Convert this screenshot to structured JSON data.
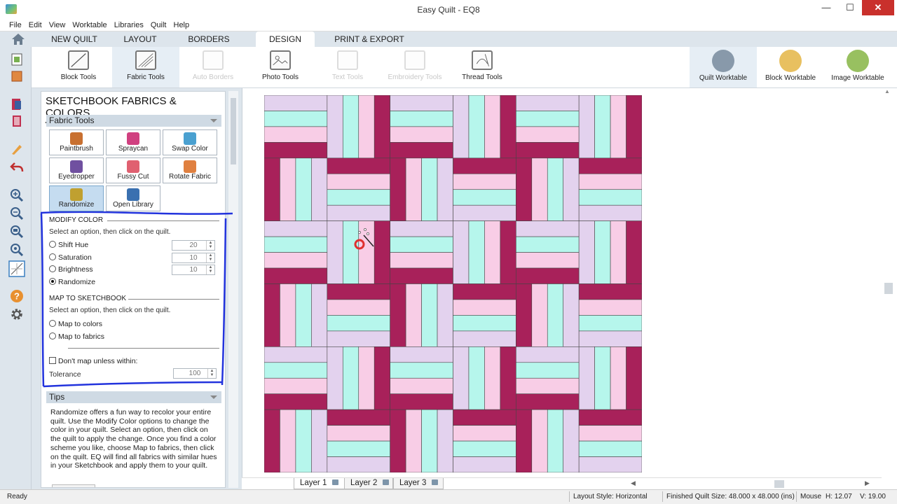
{
  "window": {
    "title": "Easy Quilt - EQ8",
    "minimize": "—",
    "maximize": "☐",
    "close": "✕"
  },
  "menu": [
    "File",
    "Edit",
    "View",
    "Worktable",
    "Libraries",
    "Quilt",
    "Help"
  ],
  "tabs": [
    {
      "label": "NEW QUILT"
    },
    {
      "label": "LAYOUT"
    },
    {
      "label": "BORDERS"
    },
    {
      "label": "DESIGN",
      "active": true
    },
    {
      "label": "PRINT & EXPORT"
    }
  ],
  "ribbon_tools": [
    {
      "label": "Block Tools",
      "enabled": true,
      "icon": "block-tools-icon"
    },
    {
      "label": "Fabric Tools",
      "enabled": true,
      "active": true,
      "icon": "fabric-tools-icon"
    },
    {
      "label": "Auto Borders",
      "enabled": false,
      "icon": "auto-borders-icon"
    },
    {
      "label": "Photo Tools",
      "enabled": true,
      "icon": "photo-tools-icon"
    },
    {
      "label": "Text Tools",
      "enabled": false,
      "icon": "text-tools-icon"
    },
    {
      "label": "Embroidery Tools",
      "enabled": false,
      "icon": "embroidery-tools-icon"
    },
    {
      "label": "Thread Tools",
      "enabled": true,
      "icon": "thread-tools-icon"
    }
  ],
  "worktables": [
    {
      "label": "Quilt Worktable",
      "active": true,
      "color": "#8899aa"
    },
    {
      "label": "Block Worktable",
      "color": "#e8c060"
    },
    {
      "label": "Image Worktable",
      "color": "#98c060"
    }
  ],
  "panel": {
    "title": "SKETCHBOOK FABRICS & COLORS",
    "fabric_tools_header": "Fabric Tools",
    "tools": [
      {
        "label": "Paintbrush",
        "color": "#c87030"
      },
      {
        "label": "Spraycan",
        "color": "#d04080"
      },
      {
        "label": "Swap Color",
        "color": "#4aa0d0"
      },
      {
        "label": "Eyedropper",
        "color": "#7050a0"
      },
      {
        "label": "Fussy Cut",
        "color": "#e06070"
      },
      {
        "label": "Rotate Fabric",
        "color": "#e08040"
      },
      {
        "label": "Randomize",
        "color": "#c0a030",
        "active": true
      },
      {
        "label": "Open Library",
        "color": "#3a70b0"
      }
    ],
    "modify_color": {
      "header": "MODIFY COLOR",
      "help": "Select an option, then click on the quilt.",
      "options": [
        {
          "label": "Shift Hue",
          "value": "20",
          "selected": false
        },
        {
          "label": "Saturation",
          "value": "10",
          "selected": false
        },
        {
          "label": "Brightness",
          "value": "10",
          "selected": false
        },
        {
          "label": "Randomize",
          "selected": true
        }
      ]
    },
    "map_to_sketchbook": {
      "header": "MAP TO SKETCHBOOK",
      "help": "Select an option, then click on the quilt.",
      "options": [
        {
          "label": "Map to colors",
          "selected": false
        },
        {
          "label": "Map to fabrics",
          "selected": false
        }
      ],
      "checkbox_label": "Don't map unless within:",
      "tolerance_label": "Tolerance",
      "tolerance_value": "100"
    },
    "tips_header": "Tips",
    "tips_text": "Randomize offers a fun way to recolor your entire quilt. Use the Modify Color options to change the color in your quilt. Select an option, then click on the quilt to apply the change. Once you find a color scheme you like, choose Map to fabrics, then click on the quilt. EQ will find all fabrics with similar hues in your Sketchbook and apply them to your quilt."
  },
  "quilt": {
    "colors": {
      "lavender": "#e3d2ee",
      "mint": "#b6f6ec",
      "pink": "#f8cde6",
      "magenta": "#a8215a"
    },
    "rows": 6,
    "cols": 6
  },
  "layers": [
    "Layer 1",
    "Layer 2",
    "Layer 3"
  ],
  "status": {
    "ready": "Ready",
    "layout_style": "Layout Style: Horizontal",
    "finished_size": "Finished Quilt Size: 48.000 x 48.000 (ins)",
    "mouse_label": "Mouse",
    "mouse_h": "H:  12.07",
    "mouse_v": "V:  19.00"
  },
  "left_toolbar_icons": [
    "add-quilt-icon",
    "open-icon",
    "sketchbook-icon",
    "library-icon",
    "pencil-icon",
    "undo-icon",
    "zoom-in-icon",
    "zoom-out-icon",
    "zoom-fit-icon",
    "zoom-actual-icon",
    "block-grid-icon",
    "help-icon",
    "settings-icon"
  ],
  "annotation_color": "#2233dd"
}
